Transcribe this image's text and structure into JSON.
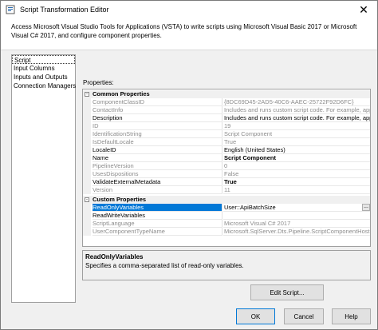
{
  "window": {
    "title": "Script Transformation Editor",
    "close_glyph": "✕"
  },
  "header": {
    "text": "Access Microsoft Visual Studio Tools for Applications (VSTA) to write scripts using Microsoft Visual Basic 2017 or Microsoft Visual C# 2017, and configure component properties."
  },
  "nav": {
    "items": [
      "Script",
      "Input Columns",
      "Inputs and Outputs",
      "Connection Managers"
    ]
  },
  "properties_label": "Properties:",
  "grid": {
    "common_header": "Common Properties",
    "common_rows": [
      {
        "name": "ComponentClassID",
        "value": "{8DC69D45-2AD5-40C6-AAEC-25722F92D6FC}"
      },
      {
        "name": "ContactInfo",
        "value": "Includes and runs custom script code. For example, apply a b"
      },
      {
        "name": "Description",
        "value": "Includes and runs custom script code. For example, apply a b"
      },
      {
        "name": "ID",
        "value": "19"
      },
      {
        "name": "IdentificationString",
        "value": "Script Component"
      },
      {
        "name": "IsDefaultLocale",
        "value": "True"
      },
      {
        "name": "LocaleID",
        "value": "English (United States)"
      },
      {
        "name": "Name",
        "value": "Script Component"
      },
      {
        "name": "PipelineVersion",
        "value": "0"
      },
      {
        "name": "UsesDispositions",
        "value": "False"
      },
      {
        "name": "ValidateExternalMetadata",
        "value": "True"
      },
      {
        "name": "Version",
        "value": "11"
      }
    ],
    "custom_header": "Custom Properties",
    "custom_rows": [
      {
        "name": "ReadOnlyVariables",
        "value": "User::ApiBatchSize"
      },
      {
        "name": "ReadWriteVariables",
        "value": ""
      },
      {
        "name": "ScriptLanguage",
        "value": "Microsoft Visual C# 2017"
      },
      {
        "name": "UserComponentTypeName",
        "value": "Microsoft.SqlServer.Dts.Pipeline.ScriptComponentHost, Micr"
      }
    ],
    "collapse_glyph": "-",
    "ellipsis": "..."
  },
  "description": {
    "title": "ReadOnlyVariables",
    "text": "Specifies a comma-separated list of read-only variables."
  },
  "buttons": {
    "edit_script": "Edit Script...",
    "ok": "OK",
    "cancel": "Cancel",
    "help": "Help"
  }
}
